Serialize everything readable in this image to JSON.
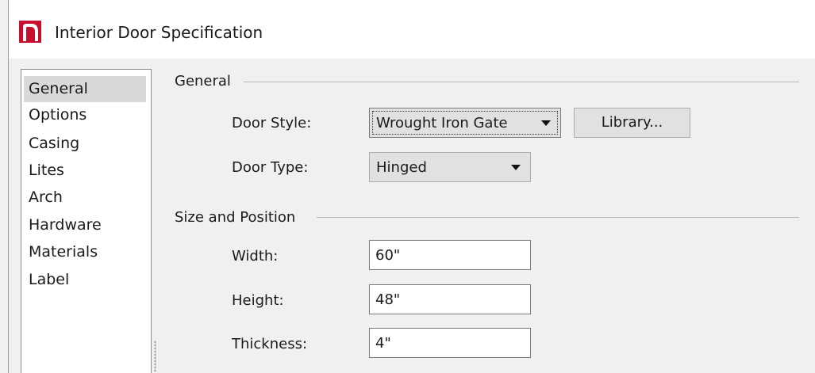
{
  "window": {
    "title": "Interior Door Specification",
    "icon": "chief-architect-app-icon"
  },
  "sidebar": {
    "items": [
      {
        "label": "General",
        "selected": true
      },
      {
        "label": "Options",
        "selected": false
      },
      {
        "label": "Casing",
        "selected": false
      },
      {
        "label": "Lites",
        "selected": false
      },
      {
        "label": "Arch",
        "selected": false
      },
      {
        "label": "Hardware",
        "selected": false
      },
      {
        "label": "Materials",
        "selected": false
      },
      {
        "label": "Label",
        "selected": false
      }
    ]
  },
  "general": {
    "group_title": "General",
    "door_style_label": "Door Style:",
    "door_style_value": "Wrought Iron Gate",
    "library_button": "Library...",
    "door_type_label": "Door Type:",
    "door_type_value": "Hinged"
  },
  "size_position": {
    "group_title": "Size and Position",
    "width_label": "Width:",
    "width_value": "60\"",
    "height_label": "Height:",
    "height_value": "48\"",
    "thickness_label": "Thickness:",
    "thickness_value": "4\""
  },
  "colors": {
    "accent": "#c8102e",
    "selection": "#d9d9d9"
  }
}
